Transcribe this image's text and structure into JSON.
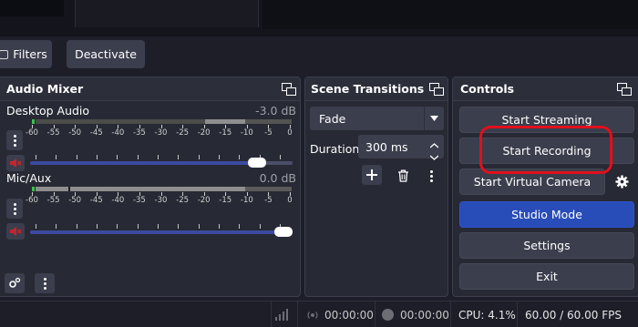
{
  "toolbar": {
    "filters_label": "Filters",
    "deactivate_label": "Deactivate"
  },
  "audio_mixer": {
    "title": "Audio Mixer",
    "scale": [
      "-60",
      "-55",
      "-50",
      "-45",
      "-40",
      "-35",
      "-30",
      "-25",
      "-20",
      "-15",
      "-10",
      "-5",
      "0"
    ],
    "channels": [
      {
        "name": "Desktop Audio",
        "db": "-3.0 dB",
        "volume_fraction": 0.87
      },
      {
        "name": "Mic/Aux",
        "db": "0.0 dB",
        "volume_fraction": 1.0
      }
    ]
  },
  "scene_transitions": {
    "title": "Scene Transitions",
    "transition": "Fade",
    "duration_label": "Duration",
    "duration_value": "300 ms"
  },
  "controls": {
    "title": "Controls",
    "start_streaming": "Start Streaming",
    "start_recording": "Start Recording",
    "start_virtual_camera": "Start Virtual Camera",
    "studio_mode": "Studio Mode",
    "settings": "Settings",
    "exit": "Exit"
  },
  "status_bar": {
    "stream_time": "00:00:00",
    "record_time": "00:00:00",
    "cpu": "CPU: 4.1%",
    "fps": "60.00 / 60.00 FPS"
  },
  "colors": {
    "studio_mode_active": "#284cb8",
    "highlight_ring": "#e0101c",
    "mute_red": "#c4262e"
  }
}
